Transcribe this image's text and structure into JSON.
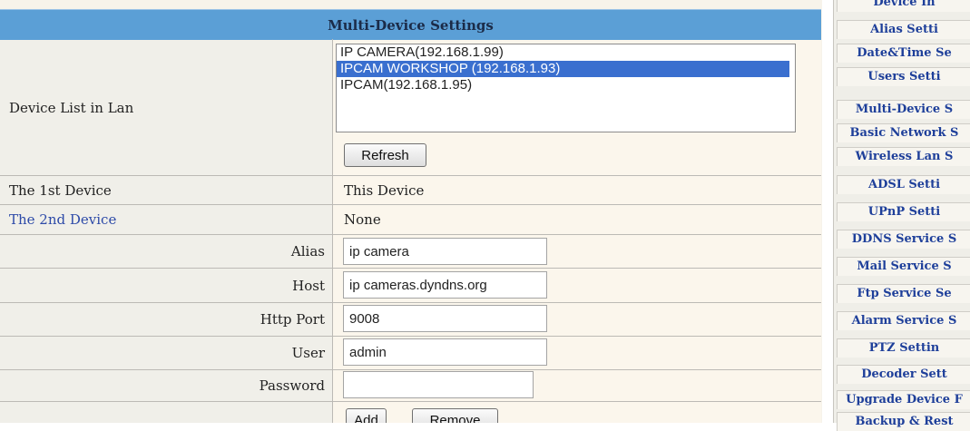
{
  "panel": {
    "title": "Multi-Device Settings",
    "device_list_label": "Device List in Lan",
    "devices": [
      "IP CAMERA(192.168.1.99)",
      "IPCAM  WORKSHOP (192.168.1.93)",
      "IPCAM(192.168.1.95)"
    ],
    "selected_device_index": 1,
    "refresh_label": "Refresh",
    "first_device_label": "The 1st Device",
    "first_device_value": "This Device",
    "second_device_label": "The 2nd Device",
    "second_device_value": "None",
    "alias_label": "Alias",
    "alias_value": "ip camera",
    "host_label": "Host",
    "host_value": "ip cameras.dyndns.org",
    "port_label": "Http Port",
    "port_value": "9008",
    "user_label": "User",
    "user_value": "admin",
    "password_label": "Password",
    "password_value": "",
    "add_label": "Add",
    "remove_label": "Remove"
  },
  "nav": {
    "items": [
      "Device In",
      "Alias Setti",
      "Date&Time Se",
      "Users Setti",
      "Multi-Device S",
      "Basic Network S",
      "Wireless Lan S",
      "ADSL Setti",
      "UPnP Setti",
      "DDNS Service S",
      "Mail Service S",
      "Ftp Service Se",
      "Alarm Service S",
      "PTZ Settin",
      "Decoder Sett",
      "Upgrade Device F",
      "Backup & Rest"
    ]
  },
  "colors": {
    "header_bg": "#5b9fd6",
    "link": "#2d4aa8",
    "nav_text": "#1e3f9a",
    "selection": "#3a6fcf"
  }
}
